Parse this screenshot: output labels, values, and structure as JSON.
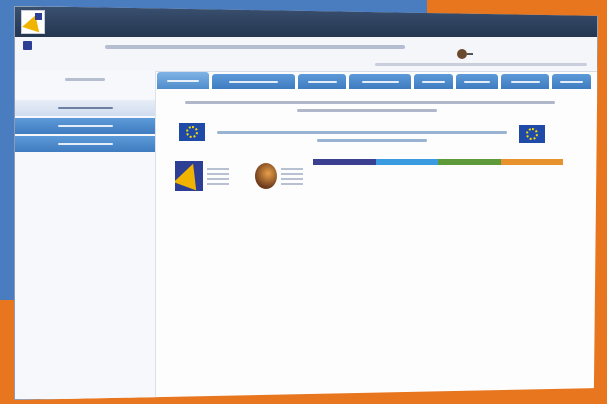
{
  "window": {
    "title": "",
    "menu_label": ""
  },
  "header": {
    "heading": "",
    "subline": ""
  },
  "sidebar": {
    "heading": "",
    "items": [
      "",
      "",
      ""
    ]
  },
  "tabs": [
    "",
    "",
    "",
    "",
    "",
    "",
    "",
    ""
  ],
  "main": {
    "welcome_line1": "",
    "welcome_line2": "",
    "funding_line1": "",
    "funding_line2": ""
  },
  "colors": {
    "titlebar": "#2e4362",
    "tab_blue": "#3f7cc0",
    "bar_segments": [
      "#3a3f8f",
      "#3b9be0",
      "#5f9a3a",
      "#e8922e"
    ]
  },
  "icons": [
    "app-logo-icon",
    "user-icon",
    "eu-flag-icon",
    "ministry-logo-icon",
    "agency-logo-icon"
  ]
}
